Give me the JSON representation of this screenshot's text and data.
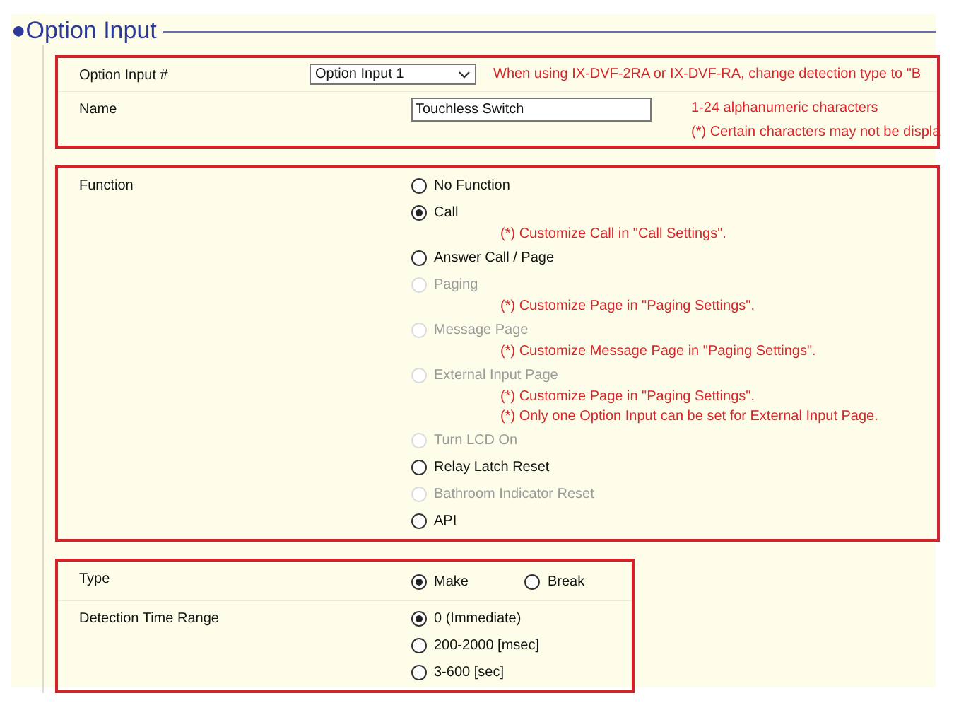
{
  "section_title": "●Option Input",
  "groups": [
    {
      "highlighted": true,
      "rows": [
        {
          "kind": "select",
          "label": "Option Input #",
          "value": "Option Input 1",
          "notes": [
            "When using IX-DVF-2RA or IX-DVF-RA, change detection  type to \"B"
          ]
        },
        {
          "kind": "text",
          "label": "Name",
          "value": "Touchless Switch",
          "notes": [
            "1-24 alphanumeric characters",
            "(*) Certain characters may not be displa"
          ]
        }
      ]
    },
    {
      "highlighted": true,
      "rows": [
        {
          "kind": "radios",
          "label": "Function",
          "options": [
            {
              "label": "No Function",
              "selected": false,
              "disabled": false
            },
            {
              "label": "Call",
              "selected": true,
              "disabled": false,
              "notes": [
                "(*) Customize Call in \"Call Settings\"."
              ]
            },
            {
              "label": "Answer Call / Page",
              "selected": false,
              "disabled": false
            },
            {
              "label": "Paging",
              "selected": false,
              "disabled": true,
              "notes": [
                "(*) Customize Page in \"Paging Settings\"."
              ]
            },
            {
              "label": "Message Page",
              "selected": false,
              "disabled": true,
              "notes": [
                "(*) Customize Message Page in \"Paging Settings\"."
              ]
            },
            {
              "label": "External Input Page",
              "selected": false,
              "disabled": true,
              "notes": [
                "(*) Customize Page in \"Paging Settings\".",
                "(*) Only one Option Input can be set for External Input Page."
              ]
            },
            {
              "label": "Turn LCD On",
              "selected": false,
              "disabled": true
            },
            {
              "label": "Relay Latch Reset",
              "selected": false,
              "disabled": false
            },
            {
              "label": "Bathroom Indicator Reset",
              "selected": false,
              "disabled": true
            },
            {
              "label": "API",
              "selected": false,
              "disabled": false
            }
          ]
        }
      ]
    },
    {
      "highlighted": true,
      "narrow": true,
      "rows": [
        {
          "kind": "inline-radios",
          "label": "Type",
          "options": [
            {
              "label": "Make",
              "selected": true,
              "disabled": false
            },
            {
              "label": "Break",
              "selected": false,
              "disabled": false
            }
          ]
        },
        {
          "kind": "radios",
          "label": "Detection Time Range",
          "options": [
            {
              "label": "0 (Immediate)",
              "selected": true,
              "disabled": false
            },
            {
              "label": "200-2000 [msec]",
              "selected": false,
              "disabled": false
            },
            {
              "label": "3-600 [sec]",
              "selected": false,
              "disabled": false
            }
          ]
        }
      ]
    }
  ]
}
